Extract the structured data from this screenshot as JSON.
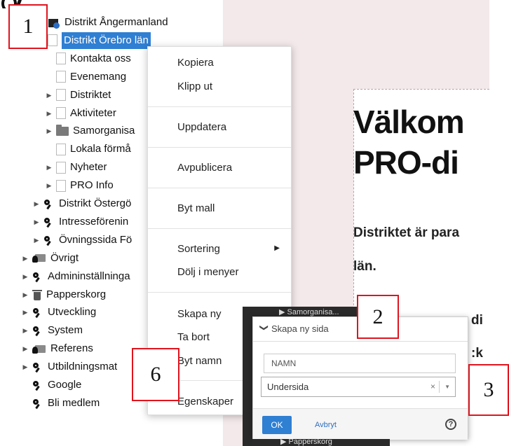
{
  "tree": {
    "nodes": [
      {
        "label": "Distrikt Ångermanland",
        "icon": "home-icon",
        "arrow": ""
      },
      {
        "label": "Distrikt Örebro län",
        "icon": "page-icon",
        "arrow": "",
        "selected": true
      },
      {
        "label": "Kontakta oss",
        "icon": "page-icon",
        "arrow": ""
      },
      {
        "label": "Evenemang",
        "icon": "page-icon",
        "arrow": ""
      },
      {
        "label": "Distriktet",
        "icon": "page-icon",
        "arrow": "▶"
      },
      {
        "label": "Aktiviteter",
        "icon": "page-icon",
        "arrow": "▶"
      },
      {
        "label": "Samorganisa",
        "icon": "folder-icon",
        "arrow": "▶"
      },
      {
        "label": "Lokala förmå",
        "icon": "page-icon",
        "arrow": ""
      },
      {
        "label": "Nyheter",
        "icon": "page-icon",
        "arrow": "▶"
      },
      {
        "label": "PRO Info",
        "icon": "page-icon",
        "arrow": "▶"
      },
      {
        "label": "Distrikt Östergö",
        "icon": "key-icon",
        "arrow": "▶"
      },
      {
        "label": "Intresseförenin",
        "icon": "key-icon",
        "arrow": "▶"
      },
      {
        "label": "Övningssida Fö",
        "icon": "key-icon",
        "arrow": "▶"
      },
      {
        "label": "Övrigt",
        "icon": "key-folder-icon",
        "arrow": "▶"
      },
      {
        "label": "Admininställninga",
        "icon": "key-icon",
        "arrow": "▶"
      },
      {
        "label": "Papperskorg",
        "icon": "trash-icon",
        "arrow": "▶"
      },
      {
        "label": "Utveckling",
        "icon": "key-icon",
        "arrow": "▶"
      },
      {
        "label": "System",
        "icon": "key-icon",
        "arrow": "▶"
      },
      {
        "label": "Referens",
        "icon": "key-folder-icon",
        "arrow": "▶"
      },
      {
        "label": "Utbildningsmat",
        "icon": "key-icon",
        "arrow": "▶"
      },
      {
        "label": "Google",
        "icon": "key-icon",
        "arrow": ""
      },
      {
        "label": "Bli medlem",
        "icon": "key-icon",
        "arrow": ""
      }
    ]
  },
  "context_menu": {
    "items": [
      {
        "label": "Kopiera"
      },
      {
        "label": "Klipp ut"
      },
      {
        "label": "Uppdatera"
      },
      {
        "label": "Avpublicera"
      },
      {
        "label": "Byt mall"
      },
      {
        "label": "Sortering",
        "submenu": "▶"
      },
      {
        "label": "Dölj i menyer"
      },
      {
        "label": "Skapa ny"
      },
      {
        "label": "Ta bort"
      },
      {
        "label": "Byt namn"
      },
      {
        "label": "Egenskaper"
      }
    ]
  },
  "preview": {
    "headline_line1": "Välkom",
    "headline_line2": "PRO-di",
    "intro_line1": "Distriktet är para",
    "intro_line2": "län.",
    "frag_a": "di",
    "frag_b": ":k"
  },
  "dialog": {
    "title": "Skapa ny sida",
    "chevron": "❯",
    "name_placeholder": "NAMN",
    "type_value": "Undersida",
    "clear": "×",
    "caret": "▼",
    "ok_label": "OK",
    "cancel_label": "Avbryt",
    "help": "?",
    "tree_frag_top": "▶ Samorganisa...",
    "tree_frag_bottom": "▶ Papperskorg"
  },
  "callouts": {
    "c1": "1",
    "c2": "2",
    "c3": "3",
    "c6": "6"
  },
  "colors": {
    "selection": "#2f7fd3",
    "callout_border": "#e0141e",
    "preview_bg": "#f3e8ea"
  }
}
